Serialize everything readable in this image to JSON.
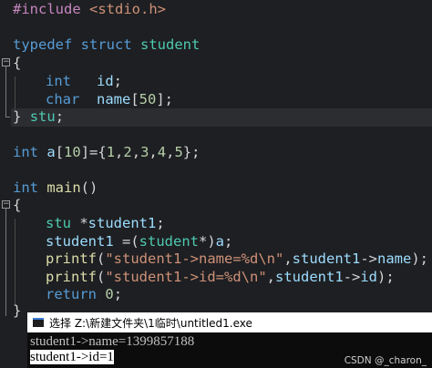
{
  "editor": {
    "lines": {
      "l1": [
        "#include",
        " ",
        "<stdio.h>"
      ],
      "l3": [
        "typedef",
        " ",
        "struct",
        " ",
        "student"
      ],
      "l4": [
        "{"
      ],
      "l5": [
        "int",
        "   ",
        "id",
        ";"
      ],
      "l6": [
        "char",
        "  ",
        "name",
        "[",
        "50",
        "];"
      ],
      "l7": [
        "}",
        " ",
        "stu",
        ";"
      ],
      "l9": [
        "int",
        " ",
        "a",
        "[",
        "10",
        "]={",
        "1",
        ",",
        "2",
        ",",
        "3",
        ",",
        "4",
        ",",
        "5",
        "};"
      ],
      "l11": [
        "int",
        " ",
        "main",
        "()"
      ],
      "l12": [
        "{"
      ],
      "l13": [
        "stu",
        " *",
        "student1",
        ";"
      ],
      "l14": [
        "student1",
        " =(",
        "student",
        "*)",
        "a",
        ";"
      ],
      "l15": [
        "printf",
        "(",
        "\"student1->name=%d\\n\"",
        ",",
        "student1",
        "->",
        "name",
        ");"
      ],
      "l16": [
        "printf",
        "(",
        "\"student1->id=%d\\n\"",
        ",",
        "student1",
        "->",
        "id",
        ");"
      ],
      "l17": [
        "return",
        " ",
        "0",
        ";"
      ],
      "l18": [
        "}"
      ]
    },
    "fold_glyph": "−"
  },
  "console": {
    "title": "选择 Z:\\新建文件夹\\1临时\\untitled1.exe",
    "output_line_1": "student1->name=1399857188",
    "output_line_2": "student1->id=1"
  },
  "watermark": "CSDN @_charon_",
  "colors": {
    "background": "#1e1f22",
    "keyword": "#569cd6",
    "type": "#4ec9b0",
    "function": "#dcdcaa",
    "string": "#ce9178",
    "number": "#b5cea8",
    "console_bg": "#0c0c0c"
  },
  "icons": {
    "fold": "fold-minus-icon",
    "console_app": "console-app-icon"
  }
}
